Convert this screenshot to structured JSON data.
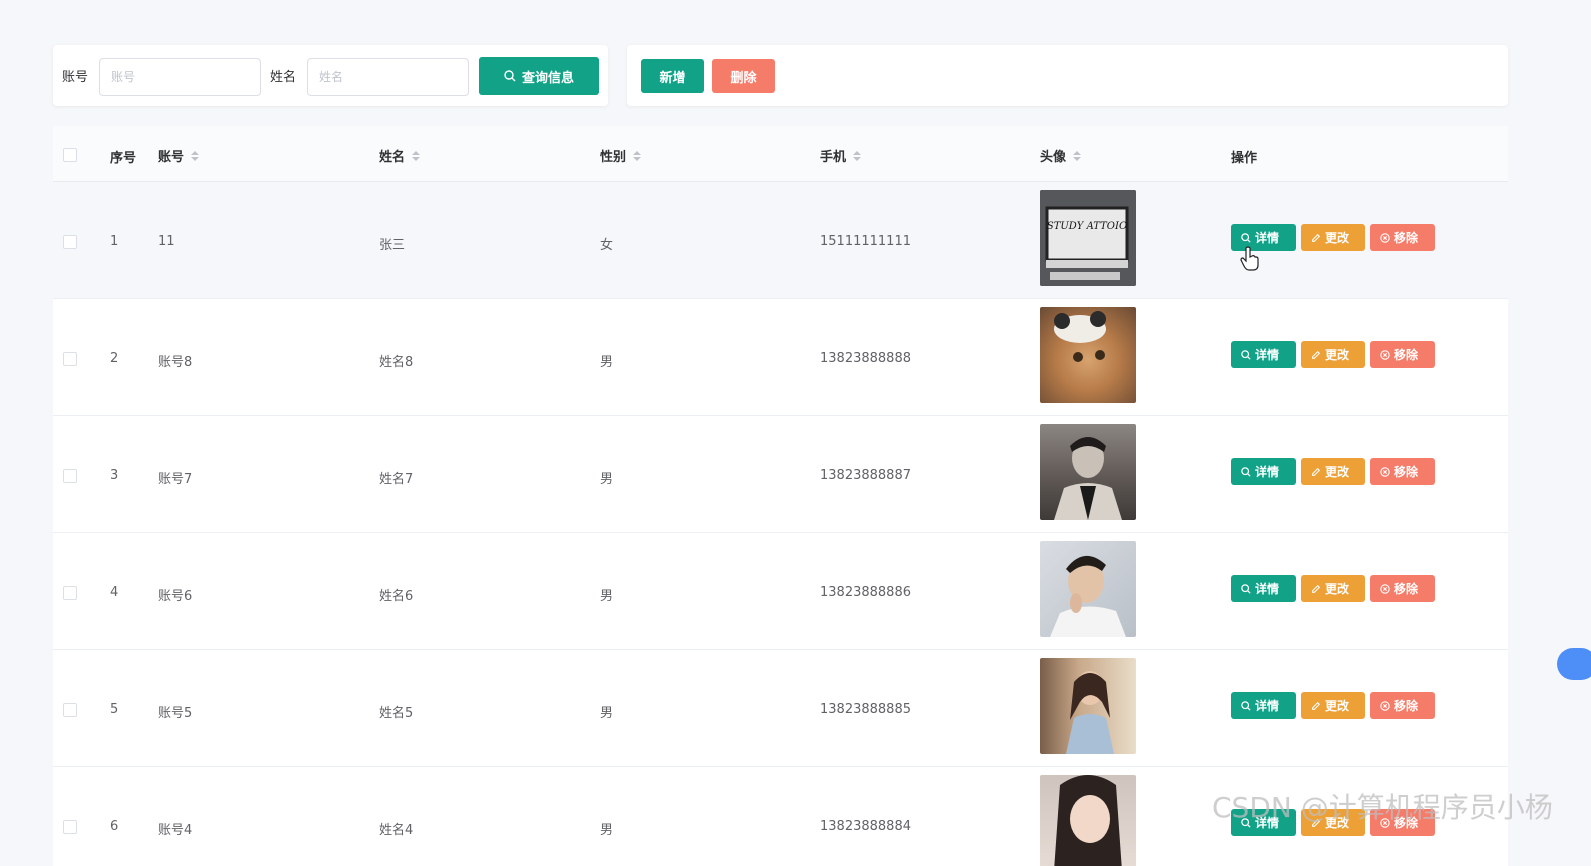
{
  "search": {
    "account_label": "账号",
    "account_placeholder": "账号",
    "name_label": "姓名",
    "name_placeholder": "姓名",
    "search_button": "查询信息"
  },
  "actions": {
    "add_button": "新增",
    "delete_button": "删除"
  },
  "table": {
    "headers": {
      "index": "序号",
      "account": "账号",
      "name": "姓名",
      "gender": "性别",
      "phone": "手机",
      "avatar": "头像",
      "operations": "操作"
    },
    "rows": [
      {
        "index": "1",
        "account": "11",
        "name": "张三",
        "gender": "女",
        "phone": "15111111111"
      },
      {
        "index": "2",
        "account": "账号8",
        "name": "姓名8",
        "gender": "男",
        "phone": "13823888888"
      },
      {
        "index": "3",
        "account": "账号7",
        "name": "姓名7",
        "gender": "男",
        "phone": "13823888887"
      },
      {
        "index": "4",
        "account": "账号6",
        "name": "姓名6",
        "gender": "男",
        "phone": "13823888886"
      },
      {
        "index": "5",
        "account": "账号5",
        "name": "姓名5",
        "gender": "男",
        "phone": "13823888885"
      },
      {
        "index": "6",
        "account": "账号4",
        "name": "姓名4",
        "gender": "男",
        "phone": "13823888884"
      }
    ],
    "row_actions": {
      "detail": "详情",
      "edit": "更改",
      "remove": "移除"
    }
  },
  "avatar_caption": "STUDY ATTOIO",
  "watermark": "CSDN @计算机程序员小杨",
  "colors": {
    "primary": "#11a288",
    "danger": "#f67c6a",
    "warning": "#eda036"
  }
}
